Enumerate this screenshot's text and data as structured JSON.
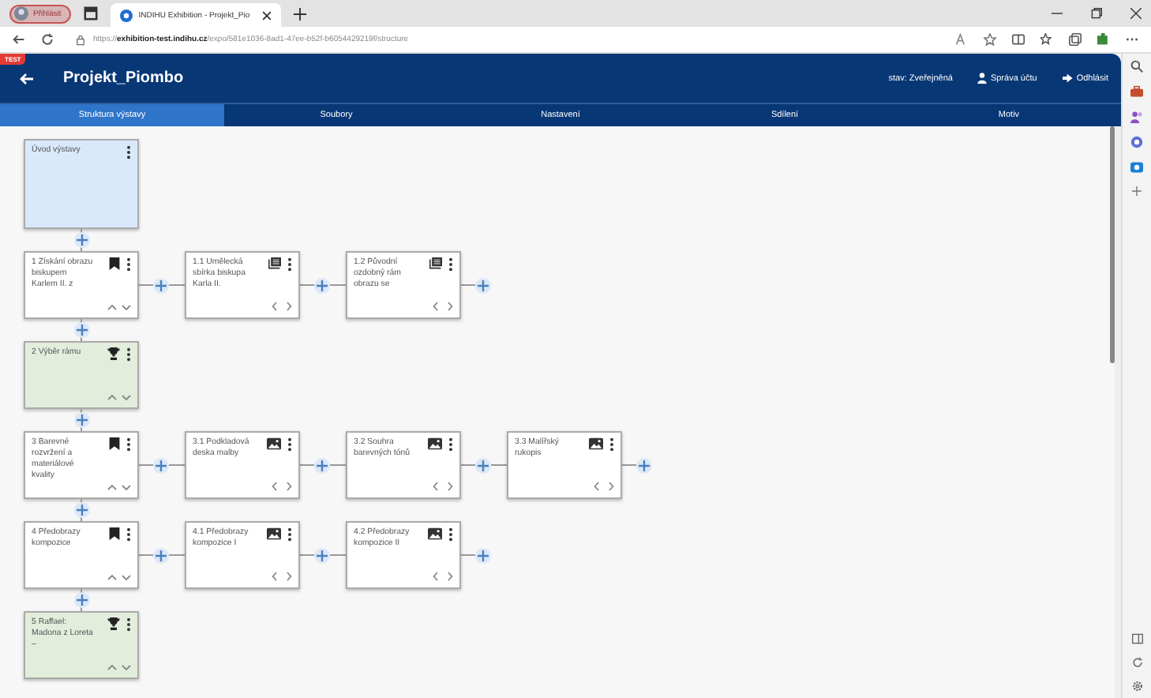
{
  "browser": {
    "profile_button": "Přihlásit",
    "tab_title": "INDIHU Exhibition - Projekt_Pio",
    "url": "https://**exhibition-test.indihu.cz**/expo/581e1036-8ad1-47ee-b52f-b6054429219f/structure"
  },
  "app": {
    "env_badge": "TEST",
    "title": "Projekt_Piombo",
    "status": "stav: Zveřejněná",
    "account": "Správa účtu",
    "logout": "Odhlásit"
  },
  "tabs": [
    {
      "label": "Struktura výstavy",
      "selected": true
    },
    {
      "label": "Soubory",
      "selected": false
    },
    {
      "label": "Nastavení",
      "selected": false
    },
    {
      "label": "Sdílení",
      "selected": false
    },
    {
      "label": "Motiv",
      "selected": false
    }
  ],
  "intro": {
    "title": "Úvod výstavy"
  },
  "chapters": [
    {
      "title": "1 Získání obrazu biskupem Karlem II. z",
      "kind": "chapter",
      "screens": [
        {
          "title": "1.1 Umělecká sbírka biskupa Karla II.",
          "kind": "text"
        },
        {
          "title": "1.2 Původní ozdobný rám obrazu se",
          "kind": "text"
        }
      ]
    },
    {
      "title": "2 Výběr rámu",
      "kind": "finale"
    },
    {
      "title": "3 Barevné rozvržení a materiálové kvality",
      "kind": "chapter",
      "screens": [
        {
          "title": "3.1 Podkladová deska malby",
          "kind": "image"
        },
        {
          "title": "3.2 Souhra barevných tónů",
          "kind": "image"
        },
        {
          "title": "3.3 Malířský rukopis",
          "kind": "image"
        }
      ]
    },
    {
      "title": "4 Předobrazy kompozice",
      "kind": "chapter",
      "screens": [
        {
          "title": "4.1 Předobrazy kompozice I",
          "kind": "image"
        },
        {
          "title": "4.2 Předobrazy kompozice II",
          "kind": "image"
        }
      ]
    },
    {
      "title": "5 Raffael: Madona z Loreta –",
      "kind": "finale"
    }
  ]
}
